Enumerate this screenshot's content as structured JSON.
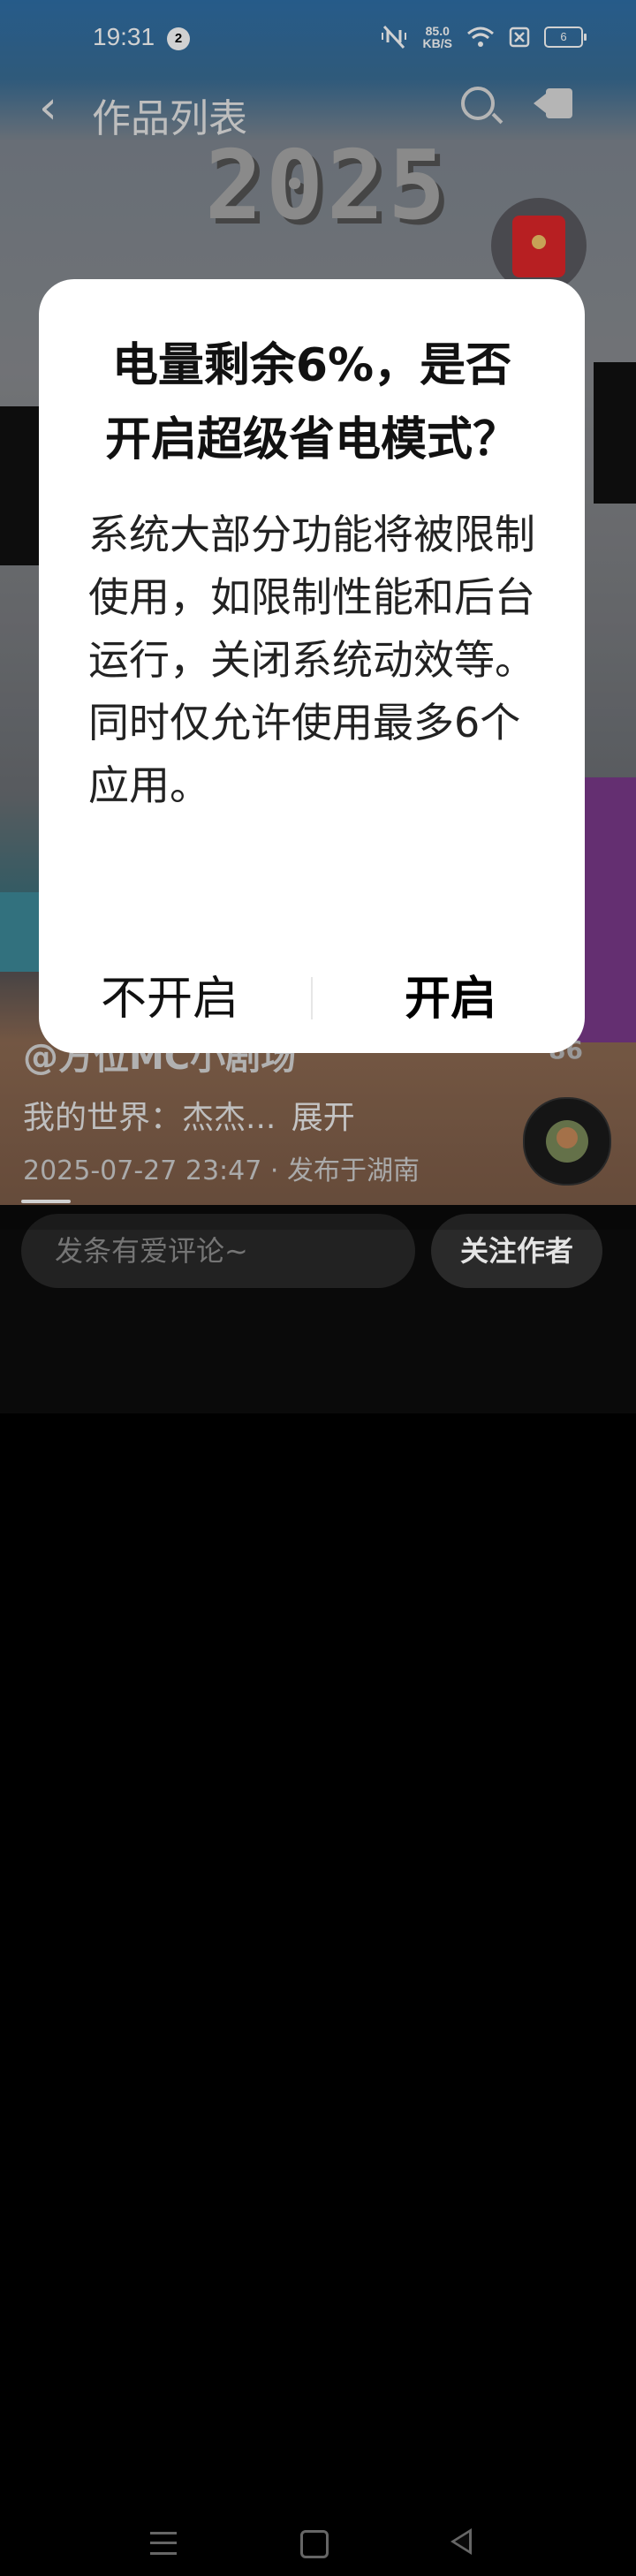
{
  "status_bar": {
    "time": "19:31",
    "notification_count": "2",
    "net_speed_value": "85.0",
    "net_speed_unit": "KB/S",
    "battery_level": "6"
  },
  "nav": {
    "title": "作品列表"
  },
  "video": {
    "year_text": "2025",
    "author": "@方位MC小剧场",
    "caption": "我的世界：杰杰...",
    "expand": "展开",
    "publish_info": "2025-07-27 23:47 · 发布于湖南",
    "side_count": "86"
  },
  "bottom_bar": {
    "comment_placeholder": "发条有爱评论~",
    "follow_label": "关注作者"
  },
  "dialog": {
    "title": "电量剩余6%，是否开启超级省电模式？",
    "body": "系统大部分功能将被限制使用，如限制性能和后台运行，关闭系统动效等。同时仅允许使用最多6个应用。",
    "cancel_label": "不开启",
    "confirm_label": "开启"
  },
  "colors": {
    "dialog_background": "#ffffff",
    "red_packet": "#e0262a",
    "bottom_bar": "#0a0a0a"
  }
}
